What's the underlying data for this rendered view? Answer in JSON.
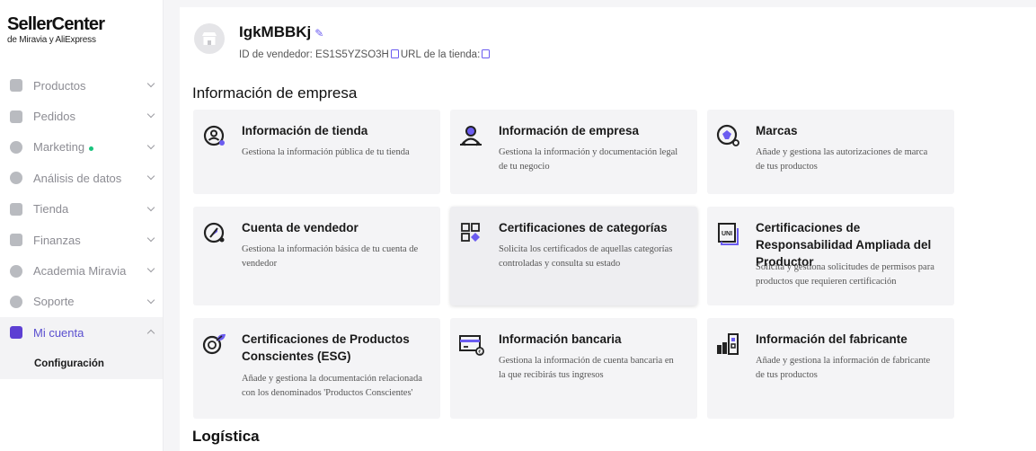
{
  "logo": {
    "title": "SellerCenter",
    "subtitle": "de Miravia y AliExpress"
  },
  "sidebar": {
    "items": [
      {
        "label": "Productos",
        "icon": "product-icon"
      },
      {
        "label": "Pedidos",
        "icon": "orders-icon"
      },
      {
        "label": "Marketing",
        "icon": "marketing-icon"
      },
      {
        "label": "Análisis de datos",
        "icon": "analytics-icon"
      },
      {
        "label": "Tienda",
        "icon": "store-icon"
      },
      {
        "label": "Finanzas",
        "icon": "finance-icon"
      },
      {
        "label": "Academia Miravia",
        "icon": "academy-icon"
      },
      {
        "label": "Soporte",
        "icon": "support-icon"
      },
      {
        "label": "Mi cuenta",
        "icon": "account-icon"
      }
    ],
    "sub_item": "Configuración"
  },
  "store": {
    "name": "IgkMBBKj",
    "seller_id_label": "ID de vendedor: ES1S5YZSO3H",
    "url_label": "URL de la tienda:"
  },
  "sections": {
    "company": "Información de empresa",
    "logistics": "Logística"
  },
  "cards": [
    {
      "title": "Información de tienda",
      "desc1": "Gestiona la información pública de tu tienda",
      "desc2": ""
    },
    {
      "title": "Información de empresa",
      "desc1": "Gestiona la información y documentación legal",
      "desc2": "de tu negocio"
    },
    {
      "title": "Marcas",
      "desc1": "Añade y gestiona las autorizaciones de marca",
      "desc2": "de tus productos"
    },
    {
      "title": "Cuenta de vendedor",
      "desc1": "Gestiona la información básica de tu cuenta de",
      "desc2": "vendedor"
    },
    {
      "title": "Certificaciones de categorías",
      "desc1": "Solicita los certificados de aquellas categorías",
      "desc2": "controladas y consulta su estado"
    },
    {
      "title": "Certificaciones de Responsabilidad Ampliada del Productor",
      "desc1": "Solicita y gestiona solicitudes de permisos para",
      "desc2": "productos que requieren certificación"
    },
    {
      "title": "Certificaciones de Productos Conscientes (ESG)",
      "desc1": "Añade y gestiona la documentación relacionada",
      "desc2": "con los denominados 'Productos Conscientes'"
    },
    {
      "title": "Información bancaria",
      "desc1": "Gestiona la información de cuenta bancaria en",
      "desc2": "la que recibirás tus ingresos"
    },
    {
      "title": "Información del fabricante",
      "desc1": "Añade y gestiona la información de fabricante",
      "desc2": "de tus productos"
    }
  ],
  "colors": {
    "accent": "#5d3fd3",
    "marketing_dot": "#19c37d",
    "card_bg": "#f4f4f6"
  }
}
